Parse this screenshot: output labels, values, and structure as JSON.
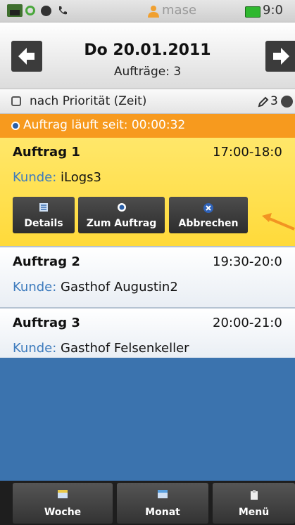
{
  "statusbar": {
    "username": "mase",
    "time": "9:0"
  },
  "header": {
    "title": "Do 20.01.2011",
    "subtitle": "Aufträge: 3"
  },
  "sortbar": {
    "label": "nach Priorität (Zeit)",
    "count": "3"
  },
  "running": {
    "text": "Auftrag läuft seit: 00:00:32"
  },
  "customer_label": "Kunde:",
  "orders": [
    {
      "name": "Auftrag 1",
      "time": "17:00-18:0",
      "customer": "iLogs3"
    },
    {
      "name": "Auftrag 2",
      "time": "19:30-20:0",
      "customer": "Gasthof Augustin2"
    },
    {
      "name": "Auftrag 3",
      "time": "20:00-21:0",
      "customer": "Gasthof Felsenkeller"
    }
  ],
  "actions": {
    "details": "Details",
    "start": "Zum Auftrag",
    "cancel": "Abbrechen"
  },
  "bottombar": {
    "week": "Woche",
    "month": "Monat",
    "menu": "Menü"
  },
  "colors": {
    "accent_orange": "#f79a1e",
    "active_yellow": "#ffe24f",
    "customer_blue": "#3d7bbd",
    "background_blue": "#3b73ae"
  },
  "icons": [
    "apps-icon",
    "sync-icon",
    "record-icon",
    "phone-icon",
    "user-icon",
    "battery-icon",
    "arrow-left-icon",
    "arrow-right-icon",
    "sort-icon",
    "pen-icon",
    "check-icon",
    "play-icon",
    "details-icon",
    "cancel-icon",
    "week-icon",
    "month-icon",
    "menu-icon"
  ]
}
